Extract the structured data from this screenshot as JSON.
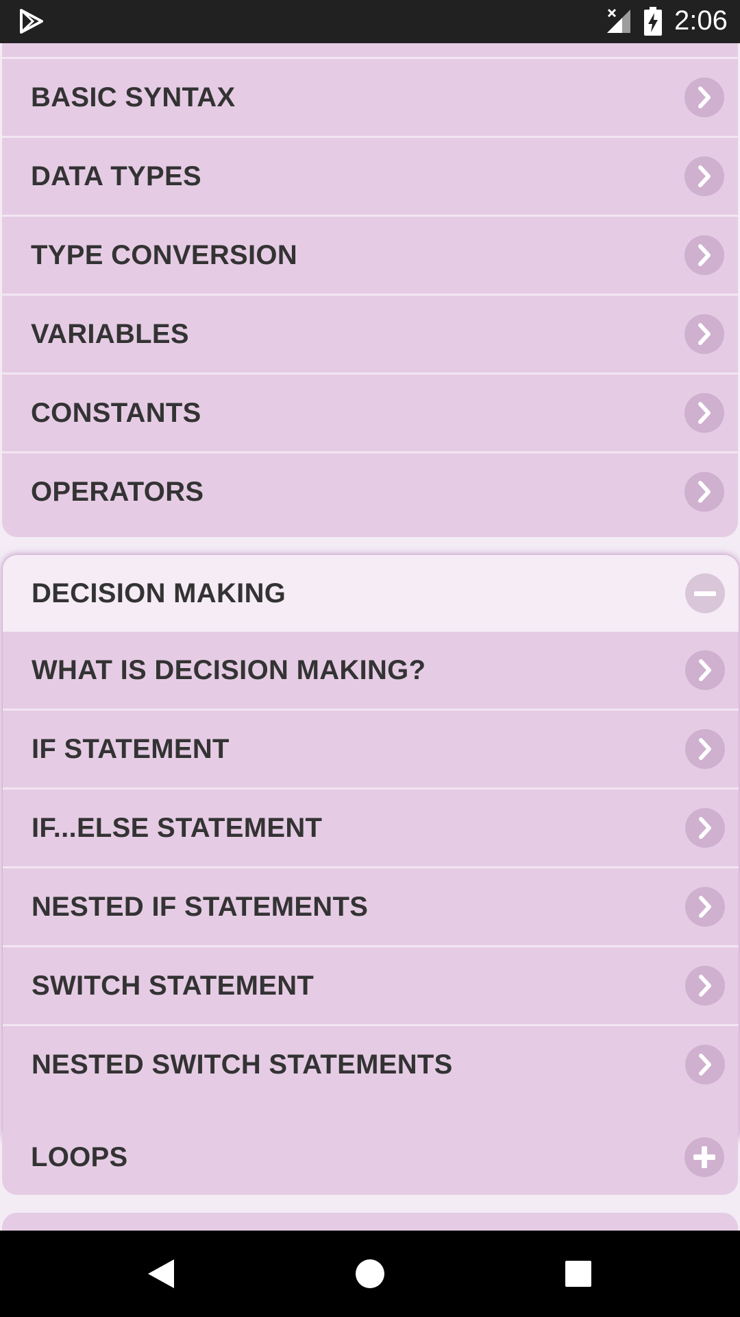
{
  "status_bar": {
    "time": "2:06",
    "icons": [
      "play-store-icon",
      "signal-icon",
      "battery-charging-icon"
    ]
  },
  "top_section": {
    "items": [
      {
        "label": "BASIC SYNTAX",
        "icon": "chevron-right-icon"
      },
      {
        "label": "DATA TYPES",
        "icon": "chevron-right-icon"
      },
      {
        "label": "TYPE CONVERSION",
        "icon": "chevron-right-icon"
      },
      {
        "label": "VARIABLES",
        "icon": "chevron-right-icon"
      },
      {
        "label": "CONSTANTS",
        "icon": "chevron-right-icon"
      },
      {
        "label": "OPERATORS",
        "icon": "chevron-right-icon"
      }
    ]
  },
  "decision_section": {
    "title": "DECISION MAKING",
    "state_icon": "collapse-minus-icon",
    "items": [
      {
        "label": "WHAT IS DECISION MAKING?",
        "icon": "chevron-right-icon"
      },
      {
        "label": "IF STATEMENT",
        "icon": "chevron-right-icon"
      },
      {
        "label": "IF...ELSE STATEMENT",
        "icon": "chevron-right-icon"
      },
      {
        "label": "NESTED IF STATEMENTS",
        "icon": "chevron-right-icon"
      },
      {
        "label": "SWITCH STATEMENT",
        "icon": "chevron-right-icon"
      },
      {
        "label": "NESTED SWITCH STATEMENTS",
        "icon": "chevron-right-icon"
      }
    ]
  },
  "loops_section": {
    "title": "LOOPS",
    "state_icon": "expand-plus-icon"
  },
  "nav_bar": {
    "buttons": [
      "back-icon",
      "home-icon",
      "recents-icon"
    ]
  },
  "colors": {
    "status_bar": "#212121",
    "background": "#f3ecf5",
    "item_background": "#e5cce4",
    "header_background": "#f5ecf5",
    "icon_circle": "#cfb0cf",
    "text": "#333333",
    "nav_bar": "#000000"
  }
}
